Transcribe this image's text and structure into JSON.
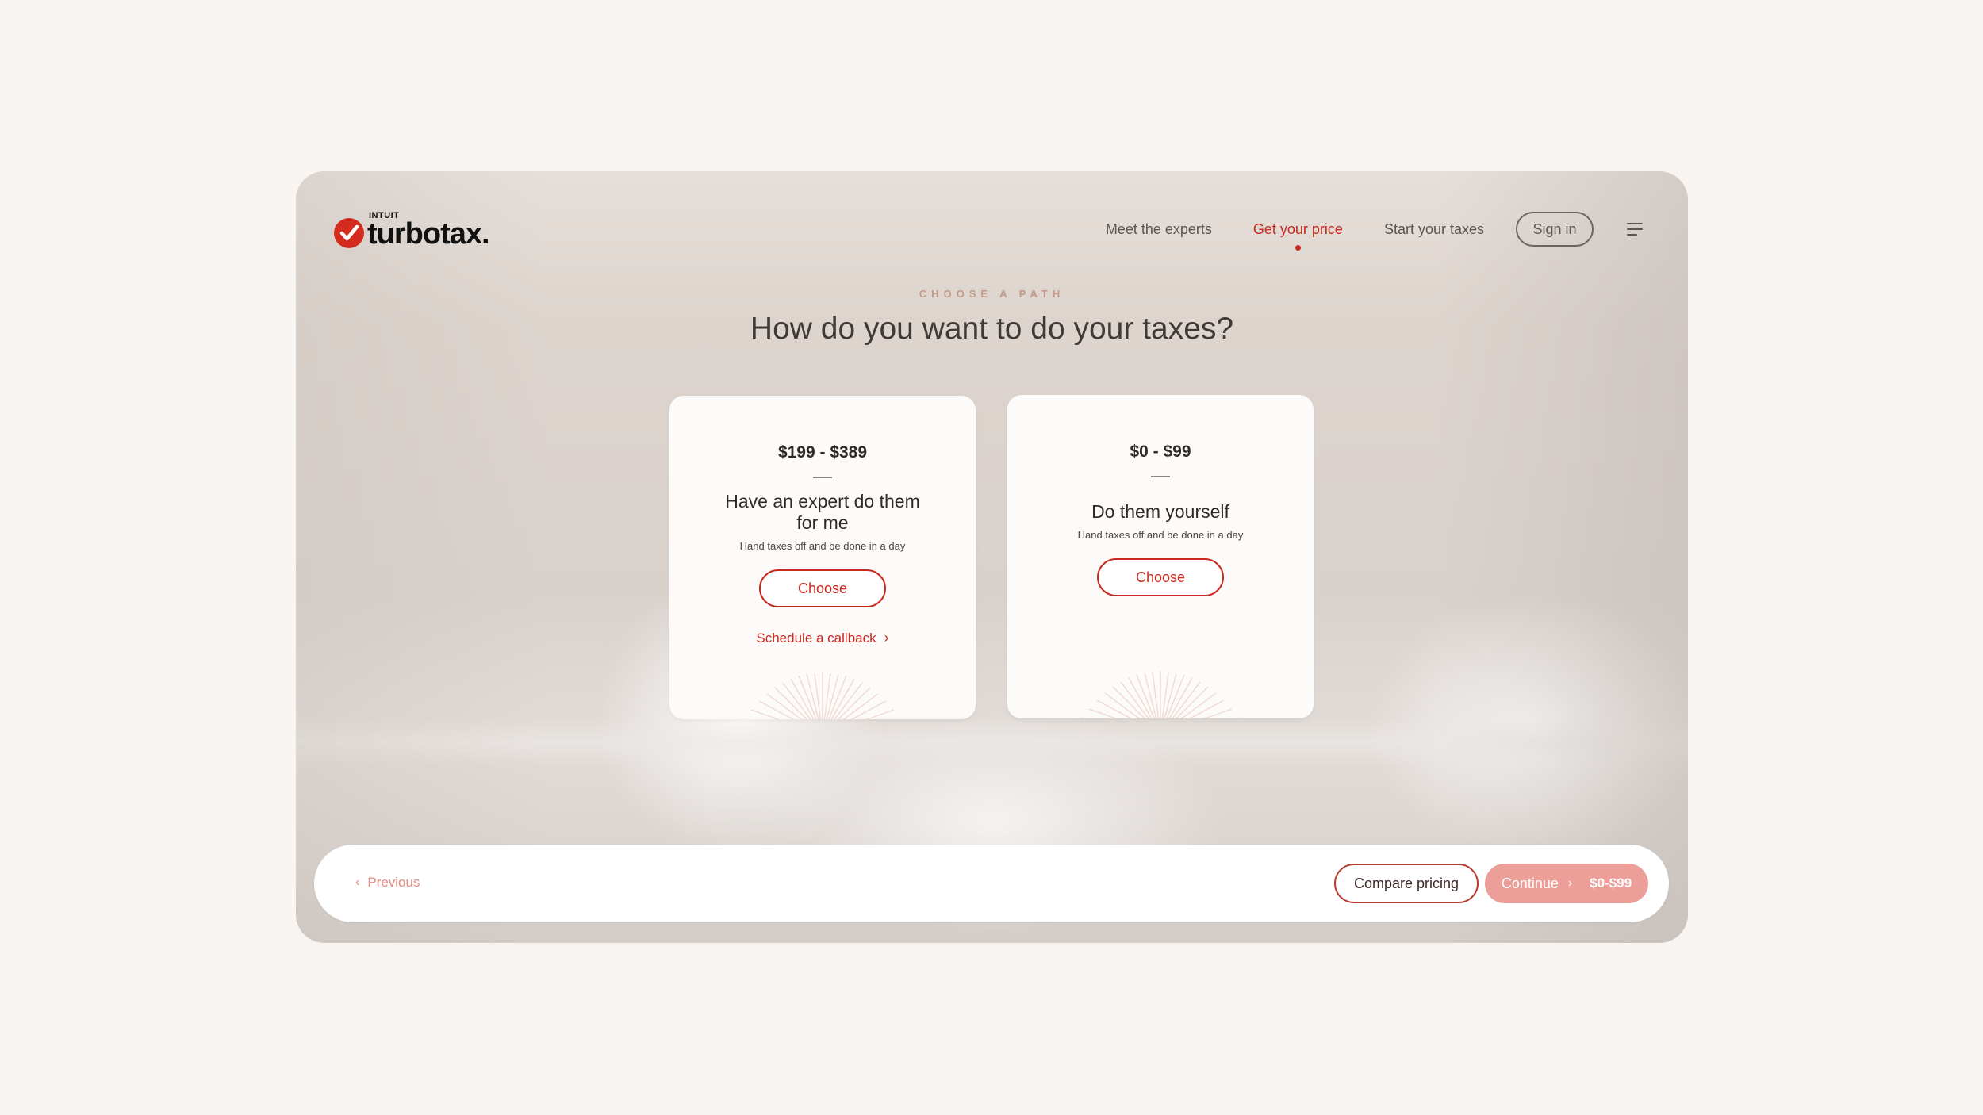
{
  "brand": {
    "intuit": "INTUIT",
    "name": "turbotax",
    "dot": ".",
    "accent": "#c8281e"
  },
  "nav": {
    "items": [
      {
        "label": "Meet the experts",
        "active": false
      },
      {
        "label": "Get your price",
        "active": true
      },
      {
        "label": "Start your taxes",
        "active": false
      }
    ],
    "sign_in": "Sign in",
    "menu_icon": "hamburger-menu-icon"
  },
  "hero": {
    "eyebrow": "CHOOSE A PATH",
    "title": "How do you want to do your taxes?"
  },
  "cards": [
    {
      "price": "$199 - $389",
      "title": "Have an expert do them for me",
      "subtitle": "Hand taxes off and be done in a day",
      "choose_label": "Choose",
      "callback_label": "Schedule a callback",
      "callback_icon": "chevron-right-icon"
    },
    {
      "price": "$0 - $99",
      "title": "Do them yourself",
      "subtitle": "Hand taxes off and be done in a day",
      "choose_label": "Choose"
    }
  ],
  "footer": {
    "previous_label": "Previous",
    "previous_icon": "chevron-left-icon",
    "compare_label": "Compare pricing",
    "continue_label": "Continue",
    "continue_icon": "chevron-right-icon",
    "continue_range": "$0-$99",
    "continue_color": "#ec9f98"
  }
}
